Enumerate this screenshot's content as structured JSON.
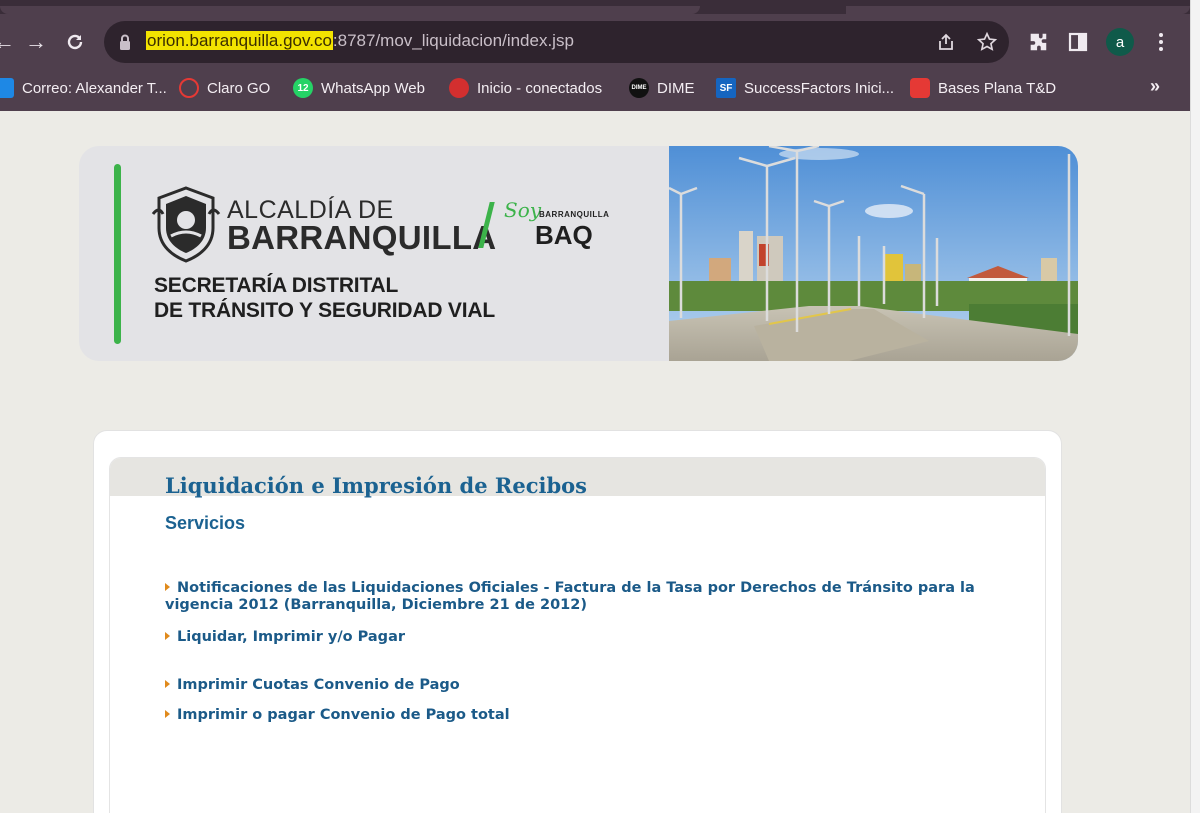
{
  "browser": {
    "url_host": "orion.barranquilla.gov.co",
    "url_rest": ":8787/mov_liquidacion/index.jsp",
    "profile_initial": "a",
    "bookmarks": [
      {
        "label": "Correo: Alexander T...",
        "icon": "outlook-icon",
        "color": "#1e88e5"
      },
      {
        "label": "Claro GO",
        "icon": "claro-icon",
        "color": "#e53935"
      },
      {
        "label": "WhatsApp Web",
        "icon": "whatsapp-icon",
        "color": "#25d366",
        "badge": "12"
      },
      {
        "label": "Inicio - conectados",
        "icon": "conectados-icon",
        "color": "#d32f2f"
      },
      {
        "label": "DIME",
        "icon": "dime-icon",
        "color": "#111111",
        "badge": "DIME"
      },
      {
        "label": "SuccessFactors Inici...",
        "icon": "successfactors-icon",
        "color": "#1565c0",
        "badge": "SF"
      },
      {
        "label": "Bases Plana T&D",
        "icon": "bases-plana-icon",
        "color": "#e53935"
      }
    ],
    "more_label": "»"
  },
  "banner": {
    "alcaldia_line1": "ALCALDÍA DE",
    "alcaldia_line2": "BARRANQUILLA",
    "soy": "Soy",
    "brand_small": "BARRANQUILLA",
    "brand_big": "BAQ",
    "secretaria_line1": "SECRETARÍA DISTRITAL",
    "secretaria_line2": "DE TRÁNSITO Y SEGURIDAD VIAL"
  },
  "content": {
    "title": "Liquidación e Impresión de Recibos",
    "subtitle": "Servicios",
    "links": [
      "Notificaciones de las Liquidaciones Oficiales - Factura de la Tasa por Derechos de Tránsito para la vigencia 2012 (Barranquilla, Diciembre 21 de 2012)",
      "Liquidar, Imprimir y/o Pagar",
      "Imprimir Cuotas Convenio de Pago",
      "Imprimir o pagar Convenio de Pago total"
    ]
  },
  "colors": {
    "link": "#1b5a88",
    "title": "#1b6291",
    "accent_green": "#3cb34a",
    "bullet": "#e08a1c"
  }
}
